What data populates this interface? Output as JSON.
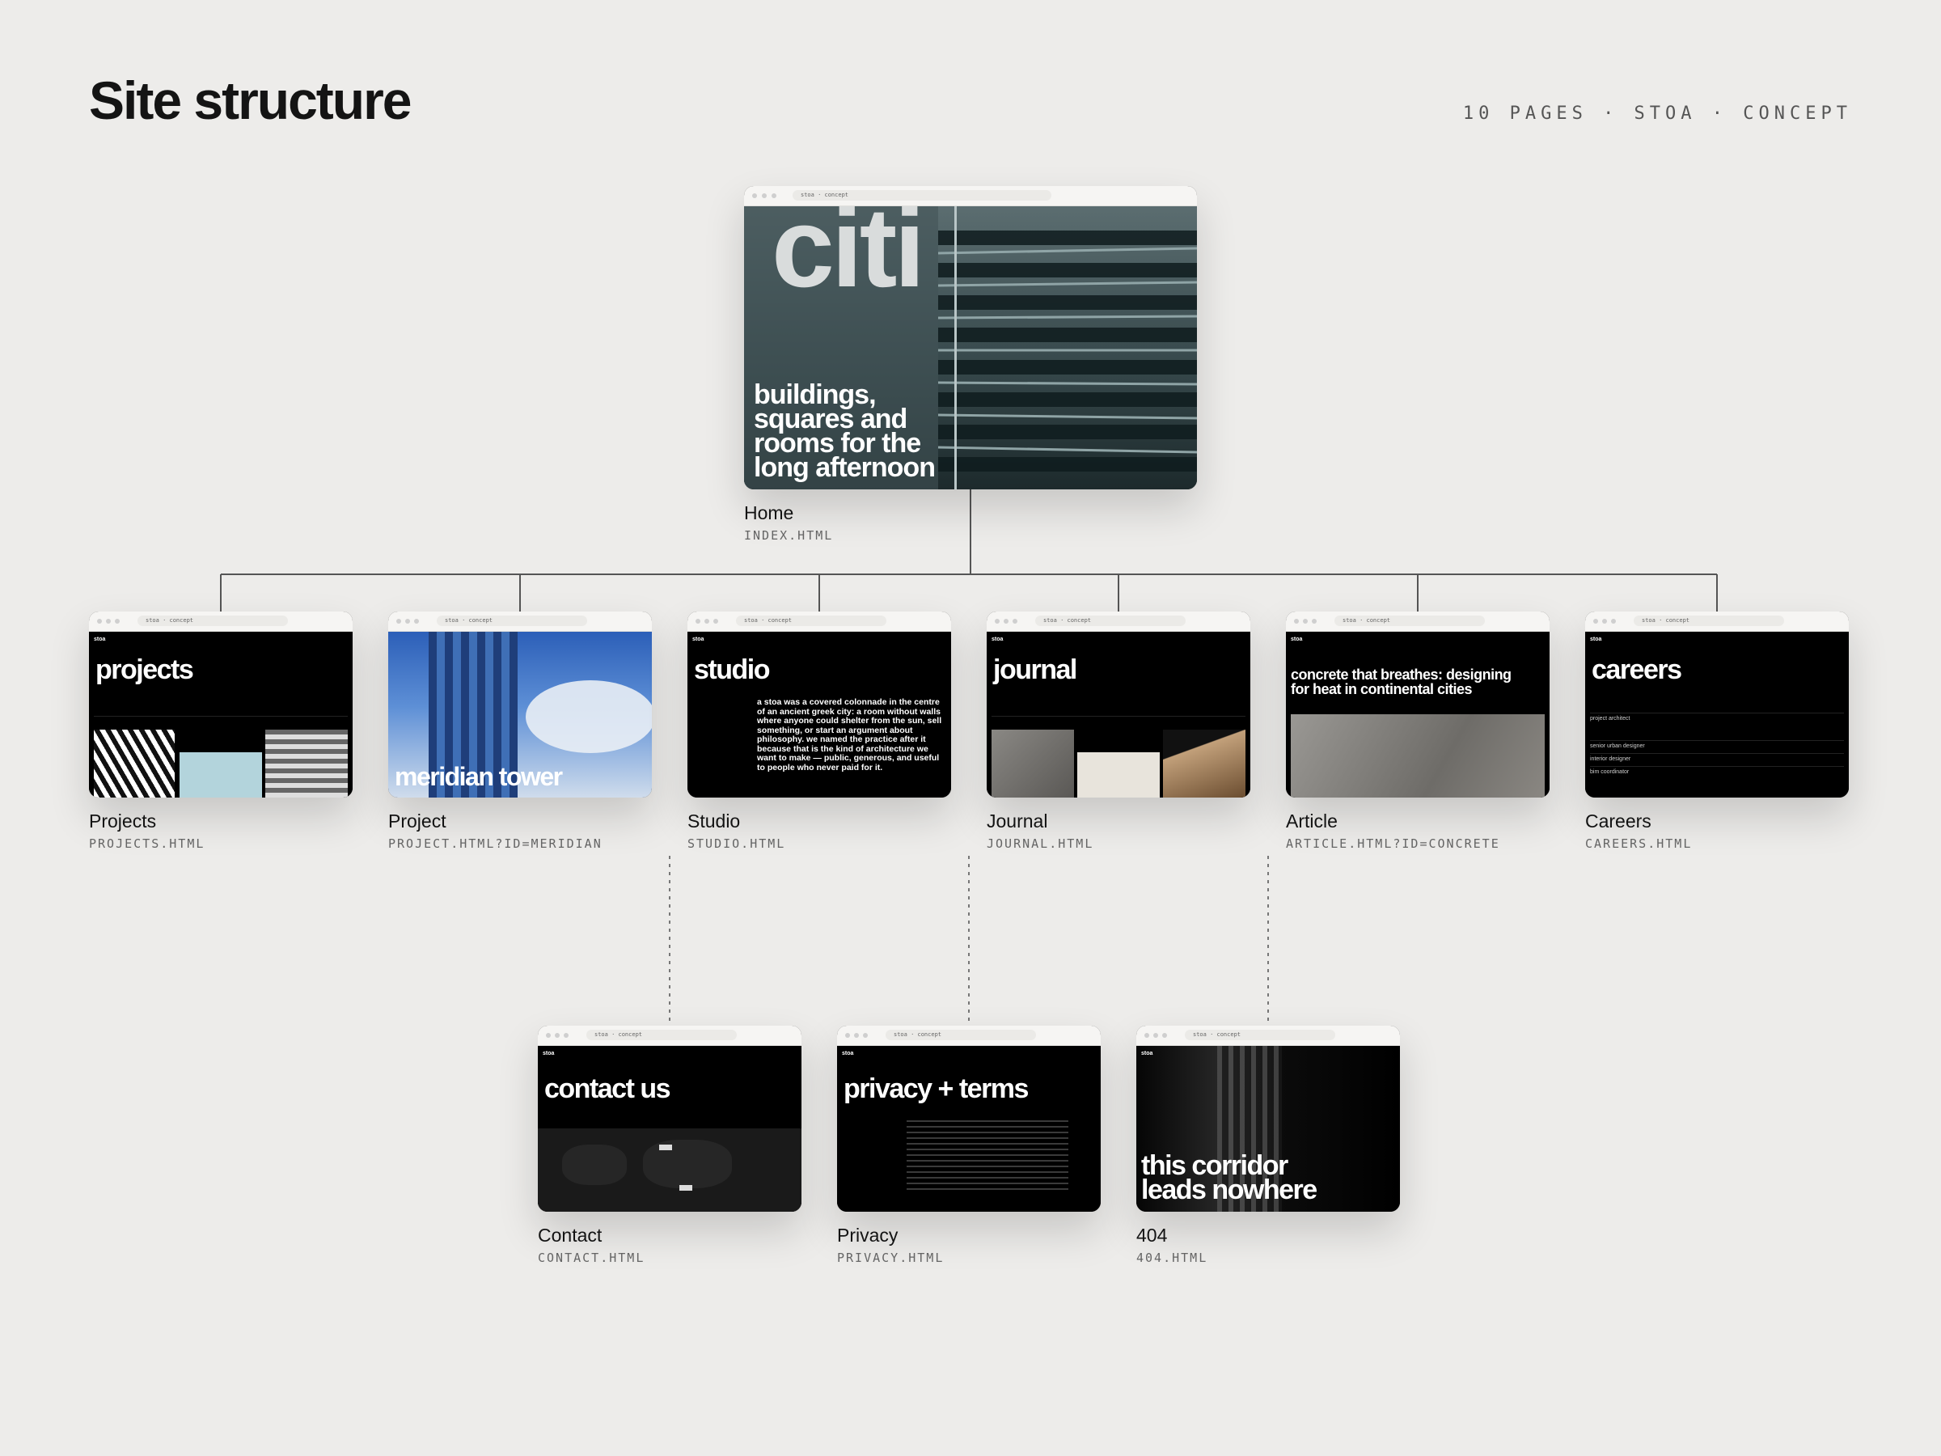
{
  "header": {
    "title": "Site structure",
    "meta": "10 PAGES · STOA · CONCEPT"
  },
  "browser_url": "stoa · concept",
  "home": {
    "label": "Home",
    "file": "INDEX.HTML",
    "logo_text": "citi",
    "hero_line1": "buildings,",
    "hero_line2": "squares and",
    "hero_line3": "rooms for the",
    "hero_line4": "long afternoon"
  },
  "level1": [
    {
      "label": "Projects",
      "file": "PROJECTS.HTML",
      "heading": "projects"
    },
    {
      "label": "Project",
      "file": "PROJECT.HTML?ID=MERIDIAN",
      "heading": "meridian tower"
    },
    {
      "label": "Studio",
      "file": "STUDIO.HTML",
      "heading": "studio",
      "body": "a stoa was a covered colonnade in the centre of an ancient greek city: a room without walls where anyone could shelter from the sun, sell something, or start an argument about philosophy. we named the practice after it because that is the kind of architecture we want to make — public, generous, and useful to people who never paid for it."
    },
    {
      "label": "Journal",
      "file": "JOURNAL.HTML",
      "heading": "journal"
    },
    {
      "label": "Article",
      "file": "ARTICLE.HTML?ID=CONCRETE",
      "heading_line1": "concrete that breathes: designing",
      "heading_line2": "for heat in continental cities"
    },
    {
      "label": "Careers",
      "file": "CAREERS.HTML",
      "heading": "careers",
      "roles": [
        "project architect",
        "senior urban designer",
        "interior designer",
        "bim coordinator"
      ]
    }
  ],
  "level2": [
    {
      "label": "Contact",
      "file": "CONTACT.HTML",
      "heading": "contact us"
    },
    {
      "label": "Privacy",
      "file": "PRIVACY.HTML",
      "heading": "privacy + terms"
    },
    {
      "label": "404",
      "file": "404.HTML",
      "heading_line1": "this corridor",
      "heading_line2": "leads nowhere"
    }
  ],
  "colors": {
    "background": "#edecea",
    "page_dark": "#000000",
    "connector": "#555555"
  },
  "thumb_logo": "stoa"
}
